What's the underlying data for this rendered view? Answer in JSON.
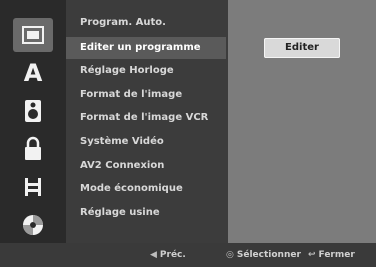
{
  "menu": {
    "items": [
      {
        "label": "Program. Auto."
      },
      {
        "label": "Editer un programme"
      },
      {
        "label": "Réglage Horloge"
      },
      {
        "label": "Format de l'image"
      },
      {
        "label": "Format de l'image VCR"
      },
      {
        "label": "Système Vidéo"
      },
      {
        "label": "AV2 Connexion"
      },
      {
        "label": "Mode économique"
      },
      {
        "label": "Réglage usine"
      }
    ]
  },
  "panel": {
    "button_label": "Editer"
  },
  "footer": {
    "prev": {
      "icon": "left-arrow-icon",
      "symbol": "◀",
      "label": "Préc."
    },
    "select": {
      "icon": "circle-icon",
      "symbol": "◎",
      "label": "Sélectionner"
    },
    "close": {
      "icon": "return-icon",
      "symbol": "↩",
      "label": "Fermer"
    }
  },
  "icons": [
    {
      "name": "disc-folder-icon",
      "glyph": "▣"
    },
    {
      "name": "language-icon",
      "glyph": "A"
    },
    {
      "name": "audio-icon",
      "glyph": "♫"
    },
    {
      "name": "lock-icon",
      "glyph": "🔒"
    },
    {
      "name": "recording-icon",
      "glyph": "⊞"
    },
    {
      "name": "disc-icon",
      "glyph": "◉"
    }
  ]
}
